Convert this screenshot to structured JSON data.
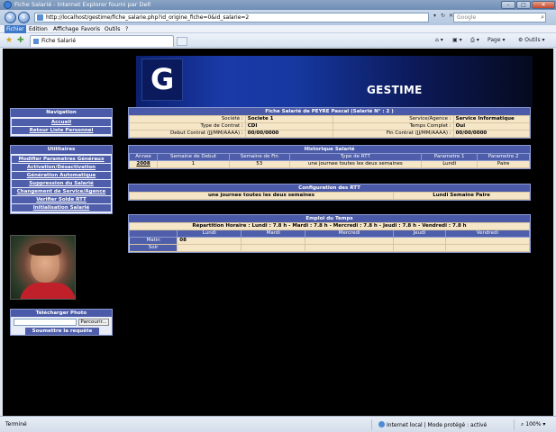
{
  "window": {
    "title": "Fiche Salarié - Internet Explorer fourni par Dell",
    "url": "http://localhost/gestime/fiche_salarie.php?id_origine_fiche=0&id_salarie=2",
    "search_placeholder": "Google"
  },
  "menu": [
    "Fichier",
    "Edition",
    "Affichage",
    "Favoris",
    "Outils",
    "?"
  ],
  "tab": {
    "title": "Fiche Salarié"
  },
  "toolbar": {
    "page": "Page",
    "outils": "Outils"
  },
  "banner": {
    "logo_letter": "G",
    "brand": "GESTIME"
  },
  "navigation": {
    "header": "Navigation",
    "links": [
      "Accueil",
      "Retour Liste Personnel"
    ]
  },
  "utilitaires": {
    "header": "Utilitaires",
    "links": [
      "Modifier Parametres Généraux",
      "Activation/Désactivation",
      "Génération Automatique",
      "Suppression du Salarié",
      "Changement de Service/Agence",
      "Verifier Solde RTT",
      "Initialisation Salarié"
    ]
  },
  "upload": {
    "header": "Télécharger Photo",
    "browse": "Parcourir...",
    "submit": "Soumettre la requête"
  },
  "fiche": {
    "header": "Fiche Salarié de PEYRE Pascal (Salarié N° : 2 )",
    "rows": [
      {
        "l1": "Société :",
        "v1": "Societe 1",
        "l2": "Service/Agence :",
        "v2": "Service Informatique"
      },
      {
        "l1": "Type de Contrat :",
        "v1": "CDI",
        "l2": "Temps Complet :",
        "v2": "Oui"
      },
      {
        "l1": "Debut Contrat (JJ/MM/AAAA) :",
        "v1": "00/00/0000",
        "l2": "Fin Contrat (JJ/MM/AAAA) :",
        "v2": "00/00/0000"
      }
    ]
  },
  "historique": {
    "header": "Historique Salarié",
    "columns": [
      "Annee",
      "Semaine de Debut",
      "Semaine de Fin",
      "Type de RTT",
      "Parametre 1",
      "Parametre 2"
    ],
    "rows": [
      [
        "2008",
        "1",
        "53",
        "une journee toutes les deux semaines",
        "Lundi",
        "Paire"
      ]
    ]
  },
  "rtt": {
    "header": "Configuration des RTT",
    "type": "une journee toutes les deux semaines",
    "param": "Lundi Semaine Paire"
  },
  "emploi": {
    "header": "Emploi du Temps",
    "repartition": "Répartition Horaire : Lundi : 7.8 h - Mardi : 7.8 h - Mercredi : 7.8 h - Jeudi : 7.8 h - Vendredi : 7.8 h",
    "days": [
      "Lundi",
      "Mardi",
      "Mercredi",
      "Jeudi",
      "Vendredi"
    ],
    "rows": [
      {
        "label": "Matin",
        "cells": [
          "08",
          "",
          "",
          "",
          ""
        ]
      },
      {
        "label": "Soir",
        "cells": [
          "",
          "",
          "",
          "",
          ""
        ]
      }
    ]
  },
  "status": {
    "left": "Terminé",
    "zone": "Internet local | Mode protégé : activé",
    "zoom": "100%"
  }
}
